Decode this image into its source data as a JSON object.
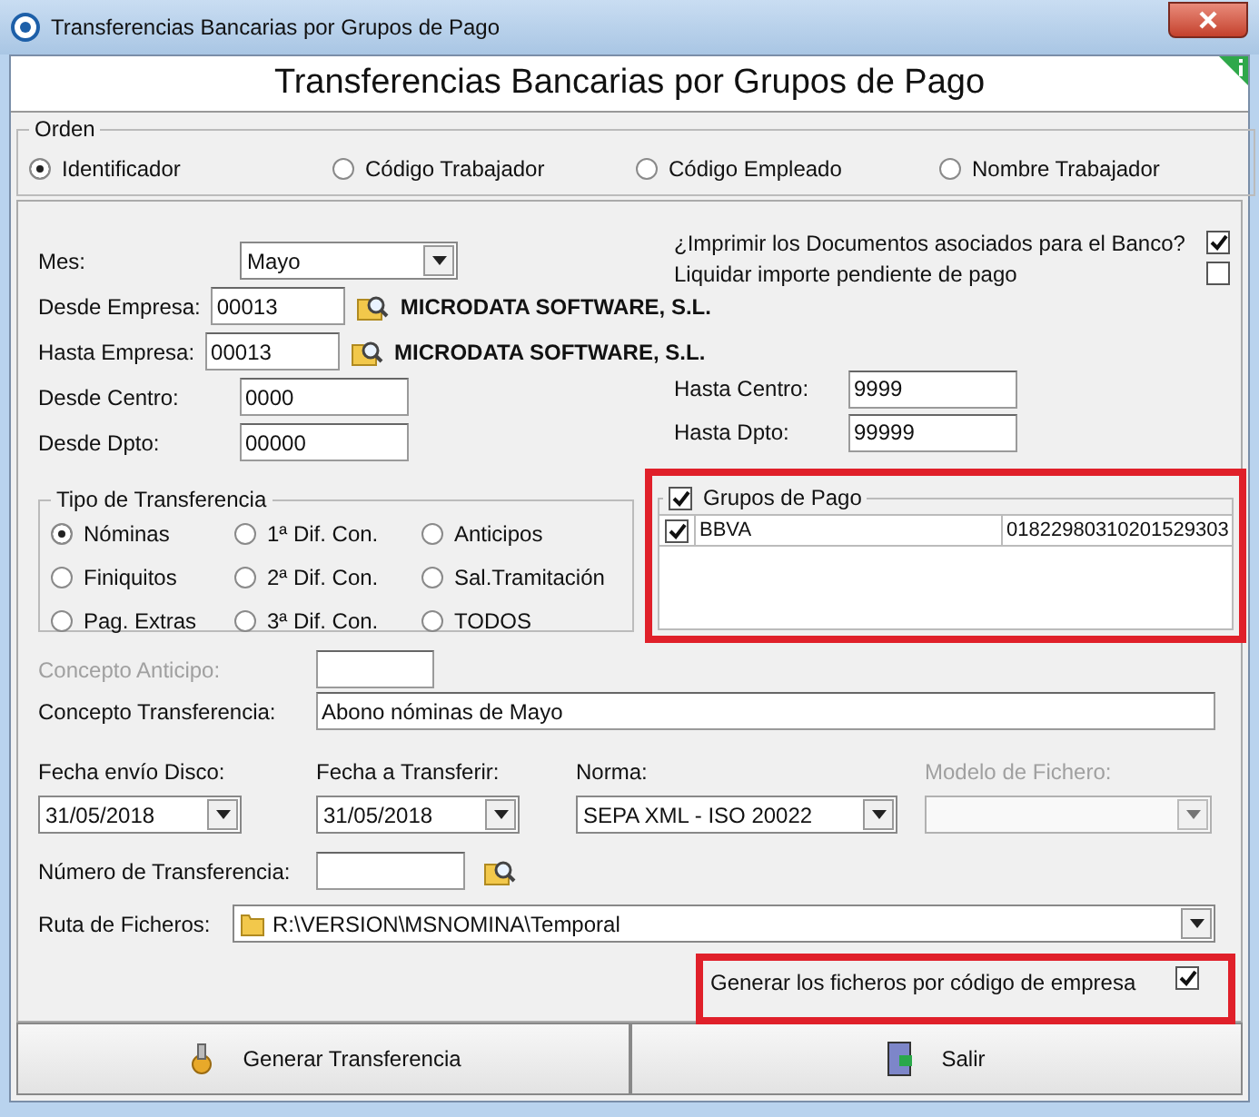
{
  "window": {
    "title": "Transferencias Bancarias por Grupos de Pago"
  },
  "header": {
    "title": "Transferencias Bancarias por Grupos de Pago"
  },
  "orden": {
    "label": "Orden",
    "options": [
      {
        "label": "Identificador",
        "selected": true
      },
      {
        "label": "Código Trabajador",
        "selected": false
      },
      {
        "label": "Código Empleado",
        "selected": false
      },
      {
        "label": "Nombre Trabajador",
        "selected": false
      }
    ]
  },
  "mes": {
    "label": "Mes:",
    "value": "Mayo"
  },
  "imprimir_documentos": {
    "label": "¿Imprimir los Documentos asociados para el Banco?",
    "checked": true
  },
  "liquidar_importe": {
    "label": "Liquidar importe pendiente de pago",
    "checked": false
  },
  "desde_empresa": {
    "label": "Desde Empresa:",
    "value": "00013",
    "name": "MICRODATA SOFTWARE, S.L."
  },
  "hasta_empresa": {
    "label": "Hasta Empresa:",
    "value": "00013",
    "name": "MICRODATA SOFTWARE, S.L."
  },
  "desde_centro": {
    "label": "Desde Centro:",
    "value": "0000"
  },
  "hasta_centro": {
    "label": "Hasta Centro:",
    "value": "9999"
  },
  "desde_dpto": {
    "label": "Desde Dpto:",
    "value": "00000"
  },
  "hasta_dpto": {
    "label": "Hasta Dpto:",
    "value": "99999"
  },
  "tipo_transferencia": {
    "label": "Tipo de Transferencia",
    "options": [
      {
        "label": "Nóminas",
        "selected": true
      },
      {
        "label": "1ª Dif. Con.",
        "selected": false
      },
      {
        "label": "Anticipos",
        "selected": false
      },
      {
        "label": "Finiquitos",
        "selected": false
      },
      {
        "label": "2ª Dif. Con.",
        "selected": false
      },
      {
        "label": "Sal.Tramitación",
        "selected": false
      },
      {
        "label": "Pag. Extras",
        "selected": false
      },
      {
        "label": "3ª Dif. Con.",
        "selected": false
      },
      {
        "label": "TODOS",
        "selected": false
      }
    ]
  },
  "grupos_pago": {
    "label": "Grupos de Pago",
    "checked": true,
    "rows": [
      {
        "checked": true,
        "name": "BBVA",
        "account": "01822980310201529303"
      }
    ]
  },
  "concepto_anticipo": {
    "label": "Concepto Anticipo:",
    "disabled": true
  },
  "concepto_transferencia": {
    "label": "Concepto Transferencia:",
    "value": "Abono nóminas de Mayo"
  },
  "fecha_envio": {
    "label": "Fecha envío Disco:",
    "value": "31/05/2018"
  },
  "fecha_transferir": {
    "label": "Fecha a Transferir:",
    "value": "31/05/2018"
  },
  "norma": {
    "label": "Norma:",
    "value": "SEPA XML - ISO 20022"
  },
  "modelo_fichero": {
    "label": "Modelo de Fichero:",
    "disabled": true
  },
  "numero_transferencia": {
    "label": "Número de Transferencia:"
  },
  "ruta_ficheros": {
    "label": "Ruta de Ficheros:",
    "value": "R:\\VERSION\\MSNOMINA\\Temporal"
  },
  "generar_por_empresa": {
    "label": "Generar los ficheros por código de empresa",
    "checked": true
  },
  "buttons": [
    {
      "label": "Generar Transferencia",
      "kind": "generate"
    },
    {
      "label": "Salir",
      "kind": "exit"
    }
  ]
}
